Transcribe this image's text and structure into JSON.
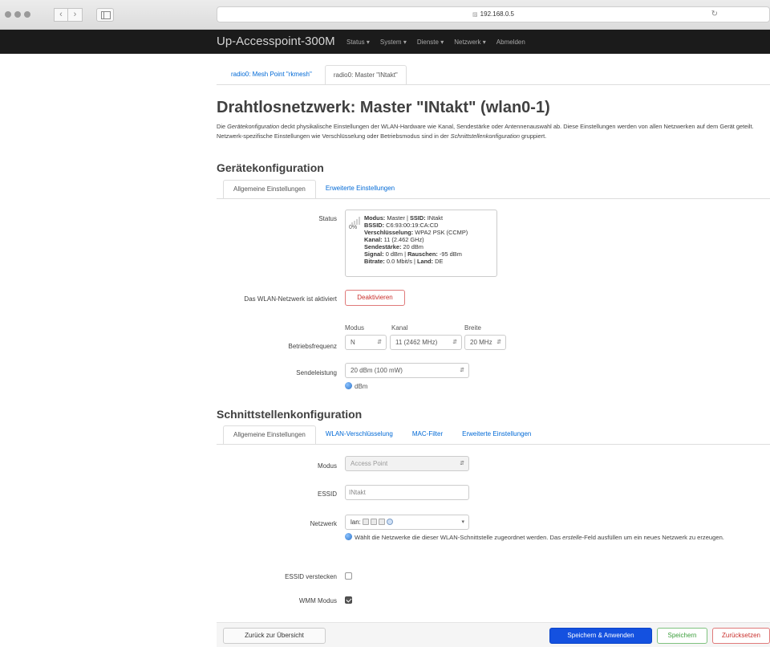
{
  "browser": {
    "url": "192.168.0.5"
  },
  "navbar": {
    "brand": "Up-Accesspoint-300M",
    "menu": [
      "Status ▾",
      "System ▾",
      "Dienste ▾",
      "Netzwerk ▾",
      "Abmelden"
    ]
  },
  "radio_tabs": [
    "radio0: Mesh Point \"rkmesh\"",
    "radio0: Master \"INtakt\""
  ],
  "page": {
    "title": "Drahtlosnetzwerk: Master \"INtakt\" (wlan0-1)",
    "desc_1": "Die ",
    "desc_em1": "Gerätekonfiguration",
    "desc_2": " deckt physikalische Einstellungen der WLAN-Hardware wie Kanal, Sendestärke oder Antennenauswahl ab. Diese Einstellungen werden von allen Netzwerken auf dem Gerät geteilt. Netzwerk-spezifische Einstellungen wie Verschlüsselung oder Betriebsmodus sind in der ",
    "desc_em2": "Schnittstellenkonfiguration",
    "desc_3": " gruppiert."
  },
  "device": {
    "heading": "Gerätekonfiguration",
    "tabs": [
      "Allgemeine Einstellungen",
      "Erweiterte Einstellungen"
    ],
    "status_label": "Status",
    "status": {
      "signal_pct": "0%",
      "modus_k": "Modus:",
      "modus_v": " Master | ",
      "ssid_k": "SSID:",
      "ssid_v": " INtakt",
      "bssid_k": "BSSID:",
      "bssid_v": " C6:93:00:19:CA:CD",
      "enc_k": "Verschlüsselung:",
      "enc_v": " WPA2 PSK (CCMP)",
      "kanal_k": "Kanal:",
      "kanal_v": " 11 (2.462 GHz)",
      "tx_k": "Sendestärke:",
      "tx_v": " 20 dBm",
      "signal_k": "Signal:",
      "signal_v": " 0 dBm | ",
      "noise_k": "Rauschen:",
      "noise_v": " -95 dBm",
      "bitrate_k": "Bitrate:",
      "bitrate_v": " 0.0 Mbit/s | ",
      "land_k": "Land:",
      "land_v": " DE"
    },
    "enabled_label": "Das WLAN-Netzwerk ist aktiviert",
    "deactivate_button": "Deaktivieren",
    "freq_label": "Betriebsfrequenz",
    "freq_cols": {
      "modus": "Modus",
      "kanal": "Kanal",
      "breite": "Breite"
    },
    "freq_values": {
      "modus": "N",
      "kanal": "11 (2462 MHz)",
      "breite": "20 MHz"
    },
    "txpower_label": "Sendeleistung",
    "txpower_value": "20 dBm (100 mW)",
    "txpower_unit": "dBm"
  },
  "iface": {
    "heading": "Schnittstellenkonfiguration",
    "tabs": [
      "Allgemeine Einstellungen",
      "WLAN-Verschlüsselung",
      "MAC-Filter",
      "Erweiterte Einstellungen"
    ],
    "modus_label": "Modus",
    "modus_value": "Access Point",
    "essid_label": "ESSID",
    "essid_value": "INtakt",
    "netz_label": "Netzwerk",
    "netz_value": "lan:",
    "netz_help_1": "Wählt die Netzwerke die dieser WLAN-Schnittstelle zugeordnet werden. Das ",
    "netz_help_em": "erstelle",
    "netz_help_2": "-Feld ausfüllen um ein neues Netzwerk zu erzeugen.",
    "hide_label": "ESSID verstecken",
    "hide_checked": false,
    "wmm_label": "WMM Modus",
    "wmm_checked": true
  },
  "footer": {
    "back": "Zurück zur Übersicht",
    "save_apply": "Speichern & Anwenden",
    "save": "Speichern",
    "reset": "Zurücksetzen"
  }
}
